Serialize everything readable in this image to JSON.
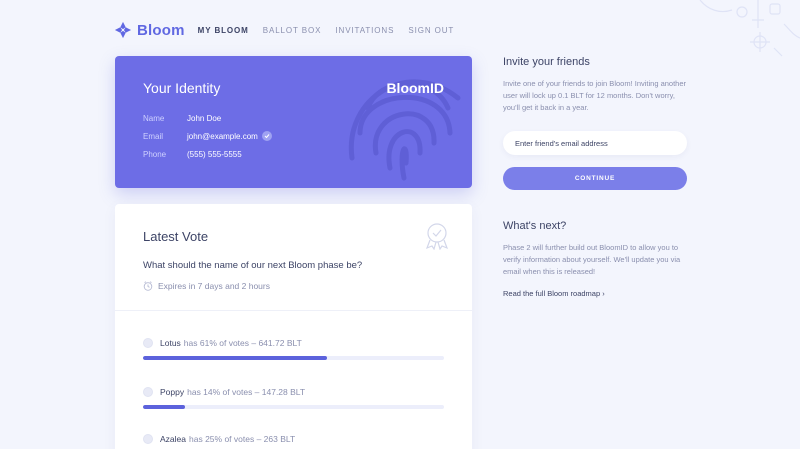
{
  "nav": {
    "brand": "Bloom",
    "links": [
      "MY BLOOM",
      "BALLOT BOX",
      "INVITATIONS",
      "SIGN OUT"
    ],
    "active_index": 0
  },
  "identity": {
    "title": "Your Identity",
    "badge": "BloomID",
    "rows": [
      {
        "label": "Name",
        "value": "John Doe"
      },
      {
        "label": "Email",
        "value": "john@example.com",
        "verified": true
      },
      {
        "label": "Phone",
        "value": "(555) 555-5555"
      }
    ]
  },
  "vote": {
    "title": "Latest Vote",
    "question": "What should the name of our next Bloom phase be?",
    "expires": "Expires in 7 days and 2 hours",
    "options": [
      {
        "name": "Lotus",
        "stats": "has 61% of votes – 641.72 BLT",
        "percent": 61
      },
      {
        "name": "Poppy",
        "stats": "has 14% of votes – 147.28 BLT",
        "percent": 14
      },
      {
        "name": "Azalea",
        "stats": "has 25% of votes – 263 BLT",
        "percent": 25
      }
    ]
  },
  "invite": {
    "title": "Invite your friends",
    "text": "Invite one of your friends to join Bloom! Inviting another user will lock up 0.1 BLT for 12 months. Don't worry, you'll get it back in a year.",
    "placeholder": "Enter friend's email address",
    "button": "CONTINUE"
  },
  "next": {
    "title": "What's next?",
    "text": "Phase 2 will further build out BloomID to allow you to verify information about yourself. We'll update you via email when this is released!",
    "link": "Read the full Bloom roadmap ›"
  },
  "colors": {
    "accent": "#6d6de6",
    "background": "#f3f5fd",
    "bar": "#5c62dc",
    "button": "#7b7fe9"
  }
}
